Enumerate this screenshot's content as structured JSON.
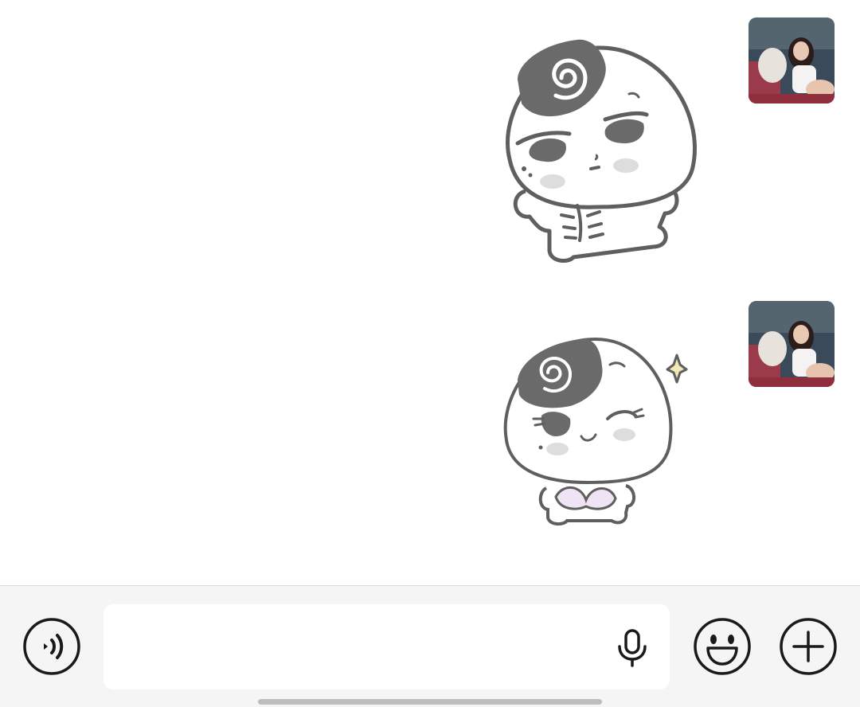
{
  "messages": [
    {
      "type": "sticker",
      "sender": "self",
      "sticker_name": "muscle-rice-ball-sticker",
      "avatar": "user-avatar"
    },
    {
      "type": "sticker",
      "sender": "self",
      "sticker_name": "wink-rice-ball-sticker",
      "avatar": "user-avatar"
    }
  ],
  "input_bar": {
    "voice_toggle_icon": "voice-mode-icon",
    "text_value": "",
    "text_placeholder": "",
    "mic_icon": "microphone-icon",
    "emoji_icon": "emoji-icon",
    "more_icon": "plus-icon"
  },
  "colors": {
    "background": "#ffffff",
    "input_bar_bg": "#f5f5f5",
    "icon_stroke": "#1a1a1a",
    "sticker_outline": "#5f5f5f",
    "sticker_cap": "#6a6a6a",
    "blush": "#dddddd",
    "bra": "#efe3f5",
    "sparkle": "#f3e9b8",
    "home_indicator": "#bdbdbd"
  }
}
